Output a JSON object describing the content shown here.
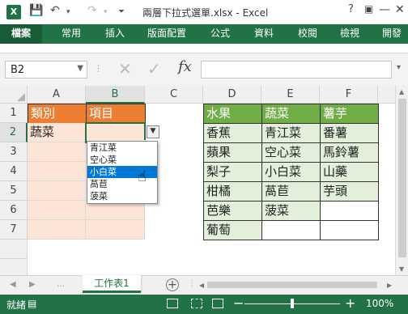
{
  "window": {
    "logo": "X",
    "title": "兩層下拉式選單.xlsx - Excel",
    "help": "?",
    "minimize": "—",
    "close": "✕",
    "undo": "↶",
    "redo": "↷",
    "qa_more": "⏷"
  },
  "ribbon": {
    "tabs": [
      "檔案",
      "常用",
      "插入",
      "版面配置",
      "公式",
      "資料",
      "校閱",
      "檢視",
      "開發"
    ]
  },
  "formula_bar": {
    "name_box": "B2",
    "cancel": "✕",
    "enter": "✓",
    "fx": "fx",
    "value": ""
  },
  "grid": {
    "columns": [
      "A",
      "B",
      "C",
      "D",
      "E",
      "F"
    ],
    "rows": [
      "1",
      "2",
      "3",
      "4",
      "5",
      "6",
      "7"
    ],
    "selected_cell": "B2",
    "cells": {
      "A1": "類別",
      "B1": "項目",
      "A2": "蔬菜",
      "D1": "水果",
      "E1": "蔬菜",
      "F1": "薯芋",
      "D2": "香蕉",
      "E2": "青江菜",
      "F2": "番薯",
      "D3": "蘋果",
      "E3": "空心菜",
      "F3": "馬鈴薯",
      "D4": "梨子",
      "E4": "小白菜",
      "F4": "山藥",
      "D5": "柑橘",
      "E5": "萵苣",
      "F5": "芋頭",
      "D6": "芭樂",
      "E6": "菠菜",
      "D7": "葡萄"
    }
  },
  "dropdown": {
    "arrow": "▼",
    "options": [
      "青江菜",
      "空心菜",
      "小白菜",
      "萵苣",
      "菠菜"
    ],
    "highlighted": "小白菜"
  },
  "sheet_tabs": {
    "tabs": [
      "工作表1"
    ],
    "add": "+"
  },
  "status_bar": {
    "status": "就緒",
    "zoom_minus": "−",
    "zoom_plus": "+",
    "zoom": "100%"
  },
  "colors": {
    "excel_green": "#217346",
    "header_orange": "#ed7d31",
    "fill_peach": "#fce4d6",
    "header_green": "#70ad47",
    "fill_green": "#e2efda",
    "highlight_blue": "#0078d7"
  }
}
